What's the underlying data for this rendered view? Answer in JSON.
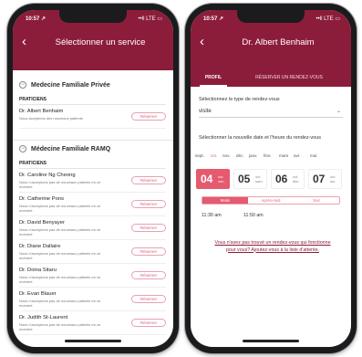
{
  "colors": {
    "brand": "#8c1d3a",
    "accent": "#e55a6f",
    "accent_light": "#e9a0b1"
  },
  "left_screen": {
    "status": {
      "time": "10:57 ↗",
      "icons": "••ll LTE ▭"
    },
    "title": "Sélectionner un service",
    "sections": [
      {
        "title": "Medecine Familiale Privée",
        "praticiens_label": "PRATICIENS",
        "doctors": [
          {
            "name": "Dr. Albert Benhaim",
            "note": "Nous acceptons des nouveaux patients",
            "button": "Réserver"
          }
        ]
      },
      {
        "title": "Médecine Familiale RAMQ",
        "praticiens_label": "PRATICIENS",
        "doctors": [
          {
            "name": "Dr. Caroline Ng Cheong",
            "note": "Nous n'acceptons pas de nouveaux patients en ce moment",
            "button": "Réserver"
          },
          {
            "name": "Dr. Catherine Pons",
            "note": "Nous n'acceptons pas de nouveaux patients en ce moment",
            "button": "Réserver"
          },
          {
            "name": "Dr. David Benyayer",
            "note": "Nous n'acceptons pas de nouveaux patients en ce moment",
            "button": "Réserver"
          },
          {
            "name": "Dr. Diane Dallaire",
            "note": "Nous n'acceptons pas de nouveaux patients en ce moment",
            "button": "Réserver"
          },
          {
            "name": "Dr. Doina Sitaru",
            "note": "Nous n'acceptons pas de nouveaux patients en ce moment",
            "button": "Réserver"
          },
          {
            "name": "Dr. Evan Blauer",
            "note": "Nous n'acceptons pas de nouveaux patients en ce moment",
            "button": "Réserver"
          },
          {
            "name": "Dr. Judith St-Laurent",
            "note": "Nous n'acceptons pas de nouveaux patients en ce moment",
            "button": "Réserver"
          }
        ]
      }
    ]
  },
  "right_screen": {
    "status": {
      "time": "10:57 ↗",
      "icons": "••ll LTE ▭"
    },
    "title": "Dr. Albert Benhaim",
    "tabs": [
      {
        "label": "PROFIL",
        "active": true
      },
      {
        "label": "RÉSERVER UN RENDEZ-VOUS",
        "active": false
      }
    ],
    "type_label": "Sélectionnez le type de rendez-vous",
    "type_value": "visite",
    "date_label": "Sélectionner la nouvelle date et l'heure du rendez-vous",
    "months": [
      "sept.",
      "oct.",
      "nov.",
      "déc.",
      "janv.",
      "févr.",
      "mars",
      "avr.",
      "mai"
    ],
    "selected_month": 1,
    "dates": [
      {
        "num": "04",
        "dow": "oct. ven.",
        "selected": true
      },
      {
        "num": "05",
        "dow": "oct. sam.",
        "selected": false
      },
      {
        "num": "06",
        "dow": "oct. dim.",
        "selected": false
      },
      {
        "num": "07",
        "dow": "oct. lun.",
        "selected": false
      }
    ],
    "periods": [
      {
        "label": "Matin",
        "selected": true
      },
      {
        "label": "Après-midi",
        "selected": false
      },
      {
        "label": "Soir",
        "selected": false
      }
    ],
    "slots": [
      "11:30 am",
      "11:50 am"
    ],
    "not_found": "Vous n'avez pas trouvé un rendez-vous qui fonctionne pour vous? Ajoutez-vous à la liste d'attente."
  }
}
